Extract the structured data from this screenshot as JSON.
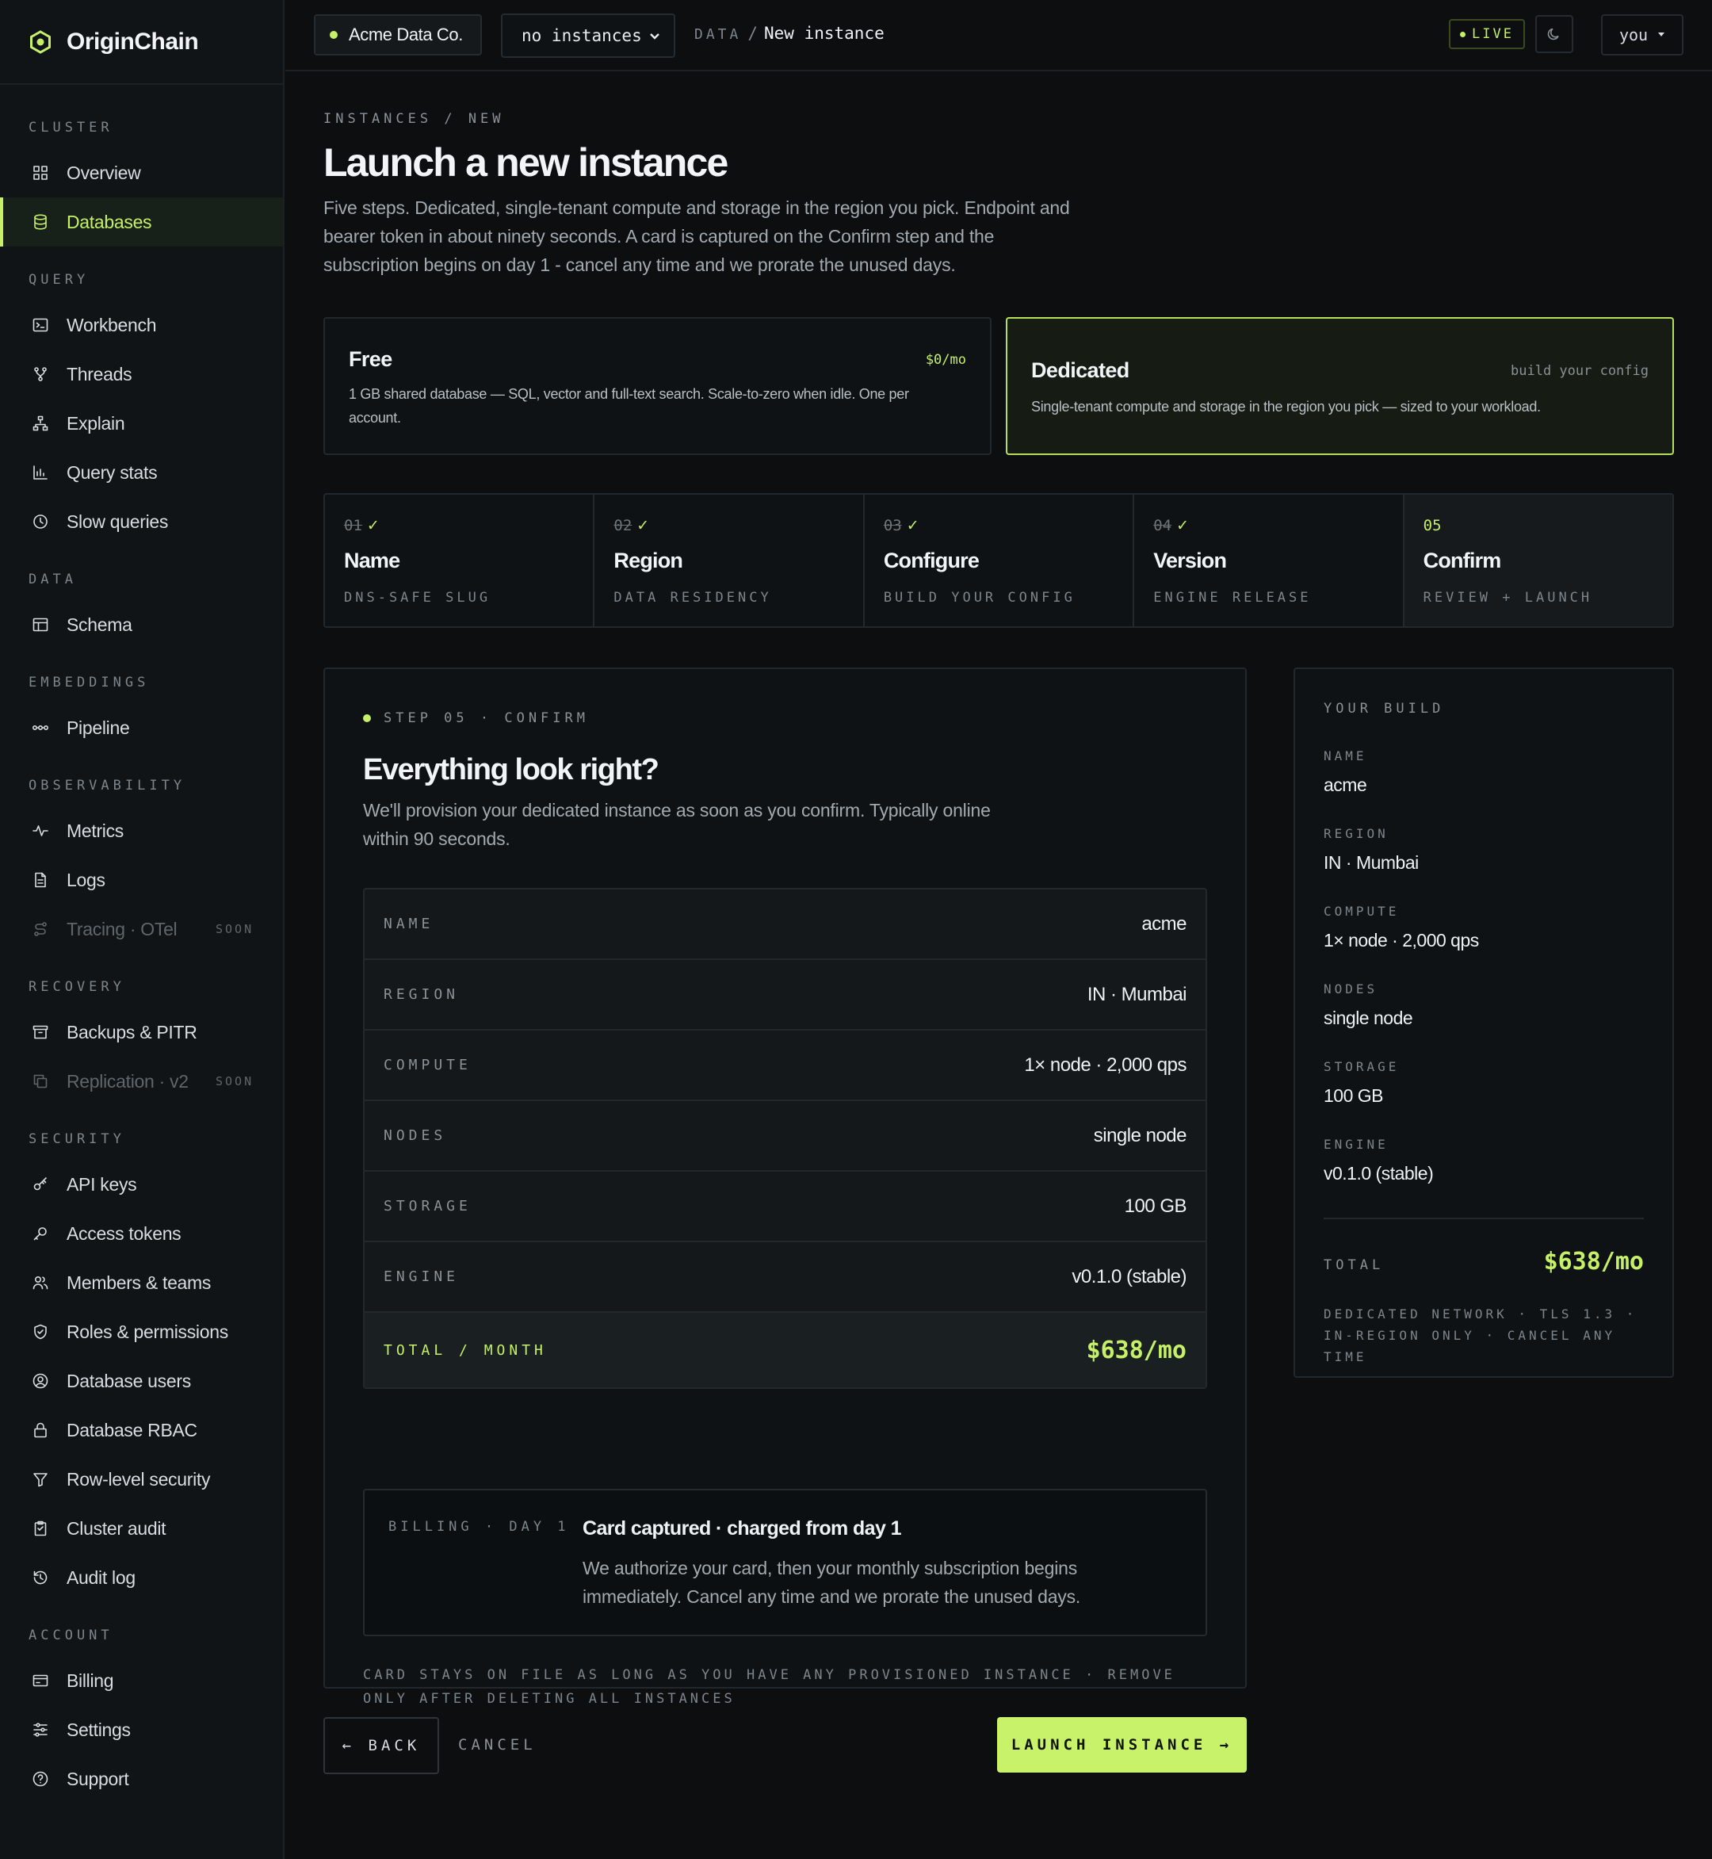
{
  "brand": {
    "name": "OriginChain"
  },
  "sidebar": {
    "sections": [
      {
        "label": "CLUSTER",
        "items": [
          {
            "label": "Overview",
            "icon": "grid-icon"
          },
          {
            "label": "Databases",
            "icon": "database-icon",
            "active": true
          }
        ]
      },
      {
        "label": "QUERY",
        "items": [
          {
            "label": "Workbench",
            "icon": "terminal-icon"
          },
          {
            "label": "Threads",
            "icon": "threads-icon"
          },
          {
            "label": "Explain",
            "icon": "tree-icon"
          },
          {
            "label": "Query stats",
            "icon": "bar-chart-icon"
          },
          {
            "label": "Slow queries",
            "icon": "clock-icon"
          }
        ]
      },
      {
        "label": "DATA",
        "items": [
          {
            "label": "Schema",
            "icon": "table-icon"
          }
        ]
      },
      {
        "label": "EMBEDDINGS",
        "items": [
          {
            "label": "Pipeline",
            "icon": "pipeline-icon"
          }
        ]
      },
      {
        "label": "OBSERVABILITY",
        "items": [
          {
            "label": "Metrics",
            "icon": "activity-icon"
          },
          {
            "label": "Logs",
            "icon": "file-icon"
          },
          {
            "label": "Tracing · OTel",
            "icon": "tracing-icon",
            "disabled": true,
            "badge": "SOON"
          }
        ]
      },
      {
        "label": "RECOVERY",
        "items": [
          {
            "label": "Backups & PITR",
            "icon": "archive-icon"
          },
          {
            "label": "Replication · v2",
            "icon": "copy-icon",
            "disabled": true,
            "badge": "SOON"
          }
        ]
      },
      {
        "label": "SECURITY",
        "items": [
          {
            "label": "API keys",
            "icon": "key-icon"
          },
          {
            "label": "Access tokens",
            "icon": "token-icon"
          },
          {
            "label": "Members & teams",
            "icon": "users-icon"
          },
          {
            "label": "Roles & permissions",
            "icon": "shield-icon"
          },
          {
            "label": "Database users",
            "icon": "user-circle-icon"
          },
          {
            "label": "Database RBAC",
            "icon": "lock-icon"
          },
          {
            "label": "Row-level security",
            "icon": "filter-icon"
          },
          {
            "label": "Cluster audit",
            "icon": "clipboard-icon"
          },
          {
            "label": "Audit log",
            "icon": "history-icon"
          }
        ]
      },
      {
        "label": "ACCOUNT",
        "items": [
          {
            "label": "Billing",
            "icon": "card-icon"
          },
          {
            "label": "Settings",
            "icon": "sliders-icon"
          },
          {
            "label": "Support",
            "icon": "help-icon"
          }
        ]
      }
    ]
  },
  "topbar": {
    "org": "Acme Data Co.",
    "instance_select": "no instances",
    "crumb_section": "DATA",
    "crumb_page": "New instance",
    "live": "LIVE",
    "user": "you"
  },
  "page": {
    "eyebrow": "INSTANCES / NEW",
    "title": "Launch a new instance",
    "lead": "Five steps. Dedicated, single-tenant compute and storage in the region you pick. Endpoint and bearer token in about ninety seconds. A card is captured on the Confirm step and the subscription begins on day 1 - cancel any time and we prorate the unused days."
  },
  "plans": {
    "free": {
      "name": "Free",
      "price": "$0/mo",
      "desc": "1 GB shared database — SQL, vector and full-text search. Scale-to-zero when idle. One per account."
    },
    "dedicated": {
      "name": "Dedicated",
      "tag": "build your config",
      "desc": "Single-tenant compute and storage in the region you pick — sized to your workload.",
      "selected": true
    }
  },
  "steps": [
    {
      "num": "01",
      "done": true,
      "title": "Name",
      "sub": "DNS-SAFE SLUG"
    },
    {
      "num": "02",
      "done": true,
      "title": "Region",
      "sub": "DATA RESIDENCY"
    },
    {
      "num": "03",
      "done": true,
      "title": "Configure",
      "sub": "BUILD YOUR CONFIG"
    },
    {
      "num": "04",
      "done": true,
      "title": "Version",
      "sub": "ENGINE RELEASE"
    },
    {
      "num": "05",
      "done": false,
      "current": true,
      "title": "Confirm",
      "sub": "REVIEW + LAUNCH"
    }
  ],
  "confirm": {
    "eyebrow": "STEP 05 · CONFIRM",
    "title": "Everything look right?",
    "lead": "We'll provision your dedicated instance as soon as you confirm. Typically online within 90 seconds.",
    "rows": [
      {
        "k": "NAME",
        "v": "acme"
      },
      {
        "k": "REGION",
        "v": "IN · Mumbai"
      },
      {
        "k": "COMPUTE",
        "v": "1× node · 2,000 qps"
      },
      {
        "k": "NODES",
        "v": "single node"
      },
      {
        "k": "STORAGE",
        "v": "100 GB"
      },
      {
        "k": "ENGINE",
        "v": "v0.1.0 (stable)"
      }
    ],
    "total_label": "TOTAL / MONTH",
    "total_value": "$638/mo",
    "billing_label": "BILLING · DAY 1",
    "billing_title": "Card captured · charged from day 1",
    "billing_desc": "We authorize your card, then your monthly subscription begins immediately. Cancel any time and we prorate the unused days.",
    "fine": "CARD STAYS ON FILE AS LONG AS YOU HAVE ANY PROVISIONED INSTANCE · REMOVE ONLY AFTER DELETING ALL INSTANCES"
  },
  "actions": {
    "back": "← BACK",
    "cancel": "CANCEL",
    "launch": "LAUNCH INSTANCE →"
  },
  "build": {
    "heading": "YOUR BUILD",
    "rows": [
      {
        "k": "NAME",
        "v": "acme"
      },
      {
        "k": "REGION",
        "v": "IN · Mumbai"
      },
      {
        "k": "COMPUTE",
        "v": "1× node · 2,000 qps"
      },
      {
        "k": "NODES",
        "v": "single node"
      },
      {
        "k": "STORAGE",
        "v": "100 GB"
      },
      {
        "k": "ENGINE",
        "v": "v0.1.0 (stable)"
      }
    ],
    "total_label": "TOTAL",
    "total_value": "$638/mo",
    "fine": "DEDICATED NETWORK · TLS 1.3 · IN-REGION ONLY · CANCEL ANY TIME"
  },
  "colors": {
    "accent": "#c5f068",
    "bg": "#0c0e10",
    "panel": "#0f1214",
    "border": "#23282c"
  }
}
